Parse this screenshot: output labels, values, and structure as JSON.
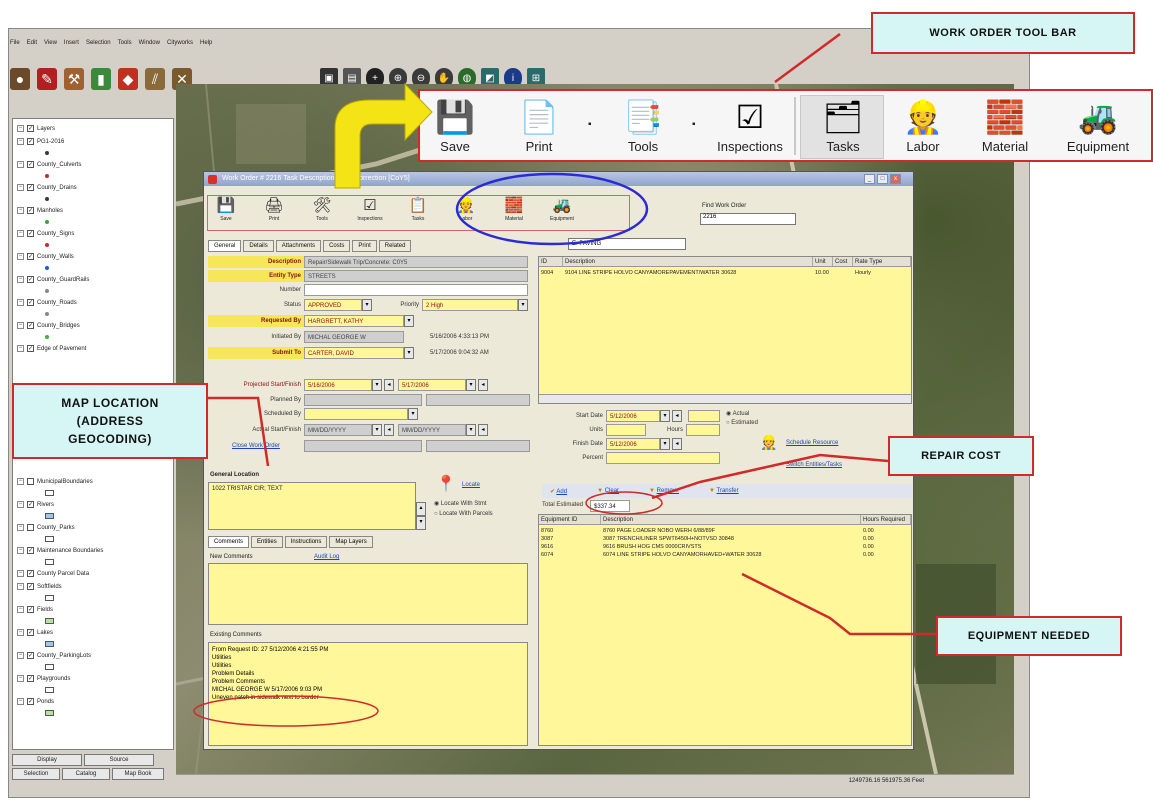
{
  "gis": {
    "menus": [
      "File",
      "Edit",
      "View",
      "Insert",
      "Selection",
      "Tools",
      "Window",
      "Cityworks",
      "Help"
    ],
    "layers": [
      {
        "name": "Layers",
        "checked": true,
        "sym": "none"
      },
      {
        "name": "PG1-2016",
        "checked": true,
        "sym": "#3a3a3a"
      },
      {
        "name": "County_Culverts",
        "checked": true,
        "sym": "#c03030"
      },
      {
        "name": "County_Drains",
        "checked": true,
        "sym": "#3a3a3a"
      },
      {
        "name": "Manholes",
        "checked": true,
        "sym": "#3aa040"
      },
      {
        "name": "County_Signs",
        "checked": true,
        "sym": "#c03030"
      },
      {
        "name": "County_Walls",
        "checked": true,
        "sym": "#2060c0"
      },
      {
        "name": "County_GuardRails",
        "checked": true,
        "sym": "#888888"
      },
      {
        "name": "County_Roads",
        "checked": true,
        "sym": "#888888"
      },
      {
        "name": "County_Bridges",
        "checked": true,
        "sym": "#40b040"
      },
      {
        "name": "Edge of Pavement",
        "checked": true,
        "sym": "none"
      }
    ],
    "layers_lower": [
      {
        "name": "MunicipalBoundaries",
        "checked": false,
        "sym": "box"
      },
      {
        "name": "Rivers",
        "checked": true,
        "sym": "box-blue"
      },
      {
        "name": "County_Parks",
        "checked": false,
        "sym": "box"
      },
      {
        "name": "Maintenance Boundaries",
        "checked": true,
        "sym": "box"
      },
      {
        "name": "County Parcel Data",
        "checked": true,
        "sym": "none"
      },
      {
        "name": "Softfields",
        "checked": true,
        "sym": "box"
      },
      {
        "name": "Fields",
        "checked": true,
        "sym": "box-green"
      },
      {
        "name": "Lakes",
        "checked": true,
        "sym": "box-blue"
      },
      {
        "name": "County_ParkingLots",
        "checked": true,
        "sym": "box"
      },
      {
        "name": "Playgrounds",
        "checked": true,
        "sym": "box"
      },
      {
        "name": "Ponds",
        "checked": true,
        "sym": "box-green"
      }
    ],
    "tabs": {
      "display": "Display",
      "source": "Source",
      "selection": "Selection",
      "catalog": "Catalog",
      "mapbook": "Map Book"
    },
    "status_coords": "1249736.16  561975.36 Feet"
  },
  "work_order": {
    "title": "Work Order # 2216  Task Description: Map Correction  [CoY5]",
    "toolbar": [
      "Save",
      "Print",
      "Tools",
      "Inspections",
      "Tasks",
      "Labor",
      "Material",
      "Equipment"
    ],
    "find_label": "Find Work Order",
    "find_value": "2216",
    "tabs": [
      "General",
      "Details",
      "Attachments",
      "Costs",
      "Print",
      "Related"
    ],
    "tab_select": "E. PAVING",
    "form": {
      "description": {
        "label": "Description",
        "value": "Repair/Sidewalk Trip/Concrete: C0Y5"
      },
      "entity_type": {
        "label": "Entity Type",
        "value": "STREETS"
      },
      "number": {
        "label": "Number",
        "value": ""
      },
      "status": {
        "label": "Status",
        "value": "APPROVED"
      },
      "priority": {
        "label": "Priority",
        "value": "2 High"
      },
      "requested_by": {
        "label": "Requested By",
        "value": "HARGRETT, KATHY"
      },
      "initiated_by": {
        "label": "Initiated By",
        "value": "MICHAL GEORGE W",
        "date": "5/16/2006 4:33:13 PM"
      },
      "submit_to": {
        "label": "Submit To",
        "value": "CARTER, DAVID",
        "date": "5/17/2006 9:04:32 AM"
      },
      "projected_start": {
        "label": "Projected Start/Finish",
        "start": "5/16/2006",
        "finish": "5/17/2006"
      },
      "planned_by": {
        "label": "Planned By"
      },
      "scheduled_by": {
        "label": "Scheduled By"
      },
      "actual_start": {
        "label": "Actual Start/Finish",
        "start": "MM/DD/YYYY",
        "finish": "MM/DD/YYYY"
      },
      "close_link": "Close Work Order"
    },
    "general_location": {
      "title": "General Location",
      "value": "1022 TRISTAR CIR; TEXT",
      "locate": "Locate",
      "opt1": "Locate With Stmt",
      "opt2": "Locate With Parcels"
    },
    "comment_tabs": [
      "Comments",
      "Entities",
      "Instructions",
      "Map Layers"
    ],
    "new_comments": "New Comments",
    "audit_log": "Audit Log",
    "existing_comments": {
      "title": "Existing Comments",
      "lines": [
        "From Request ID: 27  5/12/2006 4:21:55 PM",
        "Utilities",
        "Utilities",
        "Problem Details",
        "Problem Comments",
        "MICHAL GEORGE W  5/17/2006 9:03 PM",
        "Uneven patch in sidewalk next to border"
      ]
    },
    "task_grid": {
      "columns": [
        "ID",
        "Description",
        "Unit",
        "Cost",
        "Rate Type"
      ],
      "rows": [
        [
          "9004",
          "9104 LINE STRIPE HOLVO CANYAMOREPAVEMENT/WATER 30628",
          "10.00",
          "",
          "Hourly"
        ]
      ]
    },
    "task_detail": {
      "start_date_label": "Start Date",
      "start_date": "5/12/2006",
      "units_label": "Units",
      "hours_label": "Hours",
      "finish_label": "Finish Date",
      "finish_date": "5/12/2006",
      "percent_label": "Percent",
      "actual": "Actual",
      "estimated": "Estimated",
      "schedule_link": "Schedule Resource",
      "switch_link": "Switch Entities/Tasks"
    },
    "cost_actions": [
      "Add",
      "Clear",
      "Remove",
      "Transfer"
    ],
    "total_cost_label": "Total Estimated",
    "total_cost": "$337.34",
    "equipment_grid": {
      "columns": [
        "Equipment ID",
        "Description",
        "Hours Required"
      ],
      "rows": [
        [
          "8760",
          "8760 PAGE LOADER NOBO WERH 6/88/89F",
          "0.00"
        ],
        [
          "3087",
          "3087 TRENCH/LINER SPWT6450H+NOTVSD 30848",
          "0.00"
        ],
        [
          "9616",
          "9616 BRUSH HOG CMS 0000CRIVSTS",
          "0.00"
        ],
        [
          "6074",
          "6074 LINE STRIPE HOLVO CANYAMORHAVED+WATER 30628",
          "0.00"
        ]
      ]
    }
  },
  "big_toolbar": {
    "items": [
      "Save",
      "Print",
      "Tools",
      "Inspections",
      "Tasks",
      "Labor",
      "Material",
      "Equipment"
    ]
  },
  "callouts": {
    "toolbar": "WORK ORDER TOOL BAR",
    "map": "MAP LOCATION (ADDRESS GEOCODING)",
    "repair": "REPAIR COST",
    "equipment": "EQUIPMENT NEEDED"
  },
  "colors": {
    "callout_border": "#d02a2a",
    "callout_fill": "#d6f6f6",
    "arrow": "#f5e415",
    "ellipse_blue": "#2b2bd6",
    "field_yellow": "#fff79a"
  }
}
